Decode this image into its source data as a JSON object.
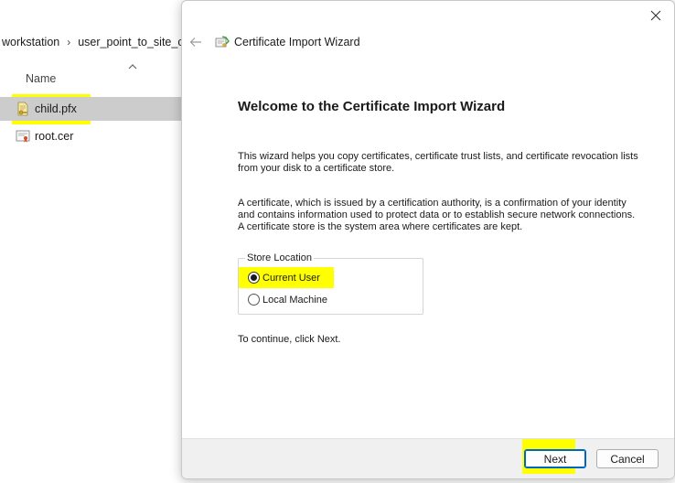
{
  "explorer": {
    "breadcrumbs": [
      "workstation",
      "user_point_to_site_ce"
    ],
    "column_header": "Name",
    "files": [
      {
        "name": "child.pfx",
        "icon": "pfx-file-icon",
        "selected": true
      },
      {
        "name": "root.cer",
        "icon": "certificate-file-icon",
        "selected": false
      }
    ]
  },
  "dialog": {
    "title": "Certificate Import Wizard",
    "heading": "Welcome to the Certificate Import Wizard",
    "paragraph1": "This wizard helps you copy certificates, certificate trust lists, and certificate revocation lists from your disk to a certificate store.",
    "paragraph2": "A certificate, which is issued by a certification authority, is a confirmation of your identity and contains information used to protect data or to establish secure network connections. A certificate store is the system area where certificates are kept.",
    "store_location": {
      "legend": "Store Location",
      "options": [
        {
          "label": "Current User",
          "checked": true
        },
        {
          "label": "Local Machine",
          "checked": false
        }
      ]
    },
    "continue_text": "To continue, click Next.",
    "buttons": {
      "next": "Next",
      "cancel": "Cancel"
    }
  },
  "colors": {
    "highlight": "#ffff00",
    "selection": "#cccccc",
    "primary_border": "#0067c0",
    "footer_bg": "#f0f0f0"
  }
}
